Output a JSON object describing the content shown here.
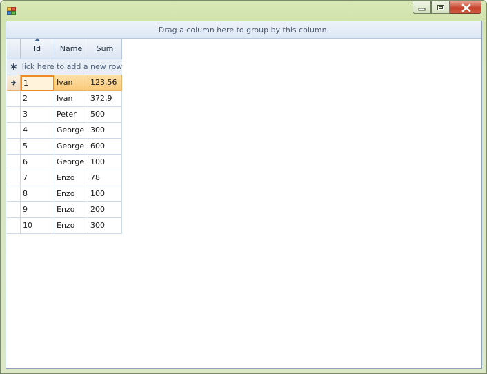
{
  "window": {
    "title": "",
    "icon": "app-form-icon",
    "buttons": [
      "minimize-icon",
      "restore-icon",
      "close-icon"
    ]
  },
  "grid": {
    "group_panel_text": "Drag a column here to group by this column.",
    "columns": [
      "Id",
      "Name",
      "Sum"
    ],
    "sorted_column": "Id",
    "new_row_text": "lick here to add a new row",
    "new_row_icon": "asterisk-icon",
    "current_row_indicator": "arrow-right-icon",
    "rows": [
      {
        "id": "1",
        "name": "Ivan",
        "sum": "123,56"
      },
      {
        "id": "2",
        "name": "Ivan",
        "sum": "372,9"
      },
      {
        "id": "3",
        "name": "Peter",
        "sum": "500"
      },
      {
        "id": "4",
        "name": "George",
        "sum": "300"
      },
      {
        "id": "5",
        "name": "George",
        "sum": "600"
      },
      {
        "id": "6",
        "name": "George",
        "sum": "100"
      },
      {
        "id": "7",
        "name": "Enzo",
        "sum": "78"
      },
      {
        "id": "8",
        "name": "Enzo",
        "sum": "100"
      },
      {
        "id": "9",
        "name": "Enzo",
        "sum": "200"
      },
      {
        "id": "10",
        "name": "Enzo",
        "sum": "300"
      }
    ]
  },
  "colors": {
    "selected_row": "#f9c979",
    "focus_border": "#f08a28",
    "header": "#dbe5f2"
  }
}
